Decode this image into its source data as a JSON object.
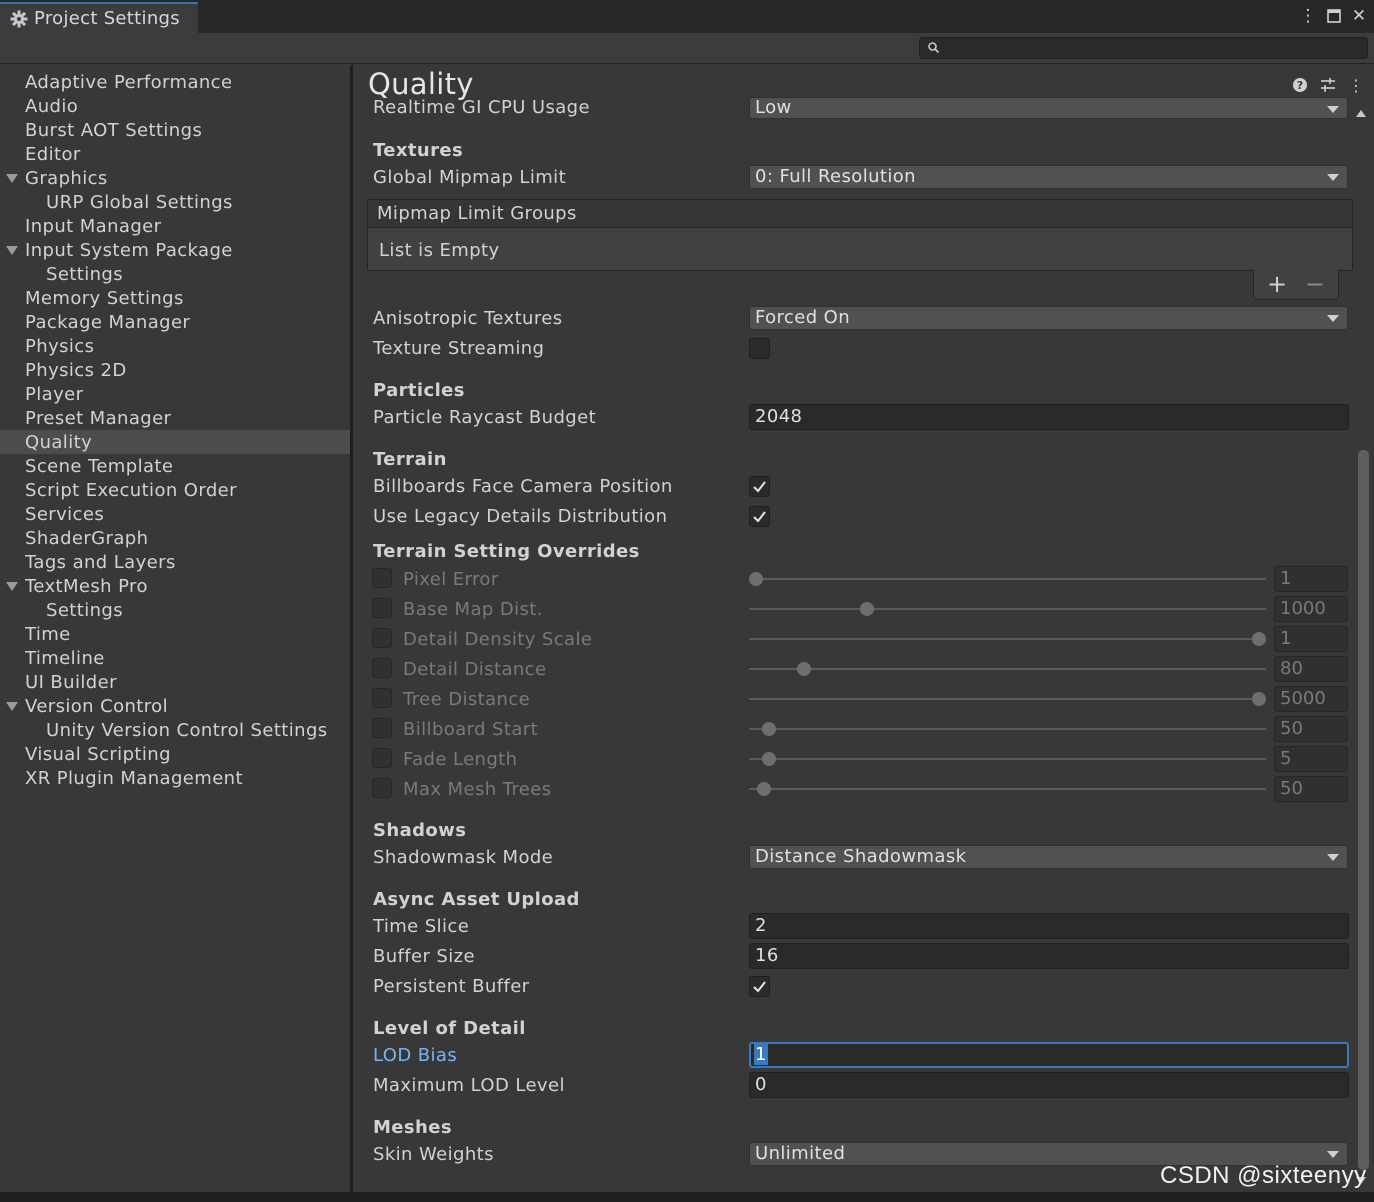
{
  "window": {
    "tab_title": "Project Settings",
    "controls": [
      "more-icon",
      "maximize-icon",
      "close-icon"
    ]
  },
  "search": {
    "value": ""
  },
  "sidebar": {
    "items": [
      {
        "label": "Adaptive Performance",
        "indent": 0,
        "expandable": false
      },
      {
        "label": "Audio",
        "indent": 0,
        "expandable": false
      },
      {
        "label": "Burst AOT Settings",
        "indent": 0,
        "expandable": false
      },
      {
        "label": "Editor",
        "indent": 0,
        "expandable": false
      },
      {
        "label": "Graphics",
        "indent": 0,
        "expandable": true
      },
      {
        "label": "URP Global Settings",
        "indent": 1,
        "expandable": false
      },
      {
        "label": "Input Manager",
        "indent": 0,
        "expandable": false
      },
      {
        "label": "Input System Package",
        "indent": 0,
        "expandable": true
      },
      {
        "label": "Settings",
        "indent": 1,
        "expandable": false
      },
      {
        "label": "Memory Settings",
        "indent": 0,
        "expandable": false
      },
      {
        "label": "Package Manager",
        "indent": 0,
        "expandable": false
      },
      {
        "label": "Physics",
        "indent": 0,
        "expandable": false
      },
      {
        "label": "Physics 2D",
        "indent": 0,
        "expandable": false
      },
      {
        "label": "Player",
        "indent": 0,
        "expandable": false
      },
      {
        "label": "Preset Manager",
        "indent": 0,
        "expandable": false
      },
      {
        "label": "Quality",
        "indent": 0,
        "expandable": false,
        "selected": true
      },
      {
        "label": "Scene Template",
        "indent": 0,
        "expandable": false
      },
      {
        "label": "Script Execution Order",
        "indent": 0,
        "expandable": false
      },
      {
        "label": "Services",
        "indent": 0,
        "expandable": false
      },
      {
        "label": "ShaderGraph",
        "indent": 0,
        "expandable": false
      },
      {
        "label": "Tags and Layers",
        "indent": 0,
        "expandable": false
      },
      {
        "label": "TextMesh Pro",
        "indent": 0,
        "expandable": true
      },
      {
        "label": "Settings",
        "indent": 1,
        "expandable": false
      },
      {
        "label": "Time",
        "indent": 0,
        "expandable": false
      },
      {
        "label": "Timeline",
        "indent": 0,
        "expandable": false
      },
      {
        "label": "UI Builder",
        "indent": 0,
        "expandable": false
      },
      {
        "label": "Version Control",
        "indent": 0,
        "expandable": true
      },
      {
        "label": "Unity Version Control Settings",
        "indent": 1,
        "expandable": false
      },
      {
        "label": "Visual Scripting",
        "indent": 0,
        "expandable": false
      },
      {
        "label": "XR Plugin Management",
        "indent": 0,
        "expandable": false
      }
    ]
  },
  "main": {
    "title": "Quality",
    "header_icons": [
      "help-icon",
      "presets-icon",
      "more-icon"
    ],
    "realtime_gi": {
      "label": "Realtime GI CPU Usage",
      "value": "Low"
    },
    "textures": {
      "section": "Textures",
      "mipmap_limit": {
        "label": "Global Mipmap Limit",
        "value": "0: Full Resolution"
      },
      "mipmap_groups": {
        "header": "Mipmap Limit Groups",
        "empty": "List is Empty",
        "add": "+",
        "remove": "−"
      },
      "anisotropic": {
        "label": "Anisotropic Textures",
        "value": "Forced On"
      },
      "streaming": {
        "label": "Texture Streaming",
        "checked": false
      }
    },
    "particles": {
      "section": "Particles",
      "raycast_budget": {
        "label": "Particle Raycast Budget",
        "value": "2048"
      }
    },
    "terrain": {
      "section": "Terrain",
      "billboards": {
        "label": "Billboards Face Camera Position",
        "checked": true
      },
      "legacy_details": {
        "label": "Use Legacy Details Distribution",
        "checked": true
      }
    },
    "terrain_overrides": {
      "section": "Terrain Setting Overrides",
      "rows": [
        {
          "label": "Pixel Error",
          "value": "1",
          "level": 0.0
        },
        {
          "label": "Base Map Dist.",
          "value": "1000",
          "level": 0.22
        },
        {
          "label": "Detail Density Scale",
          "value": "1",
          "level": 1.0
        },
        {
          "label": "Detail Distance",
          "value": "80",
          "level": 0.095
        },
        {
          "label": "Tree Distance",
          "value": "5000",
          "level": 1.0
        },
        {
          "label": "Billboard Start",
          "value": "50",
          "level": 0.025
        },
        {
          "label": "Fade Length",
          "value": "5",
          "level": 0.025
        },
        {
          "label": "Max Mesh Trees",
          "value": "50",
          "level": 0.015
        }
      ]
    },
    "shadows": {
      "section": "Shadows",
      "shadowmask": {
        "label": "Shadowmask Mode",
        "value": "Distance Shadowmask"
      }
    },
    "async_upload": {
      "section": "Async Asset Upload",
      "time_slice": {
        "label": "Time Slice",
        "value": "2"
      },
      "buffer_size": {
        "label": "Buffer Size",
        "value": "16"
      },
      "persistent": {
        "label": "Persistent Buffer",
        "checked": true
      }
    },
    "lod": {
      "section": "Level of Detail",
      "lod_bias": {
        "label": "LOD Bias",
        "value": "1"
      },
      "max_lod": {
        "label": "Maximum LOD Level",
        "value": "0"
      }
    },
    "meshes": {
      "section": "Meshes",
      "skin_weights": {
        "label": "Skin Weights",
        "value": "Unlimited"
      }
    }
  },
  "watermark": "CSDN @sixteenyy",
  "colors": {
    "accent": "#3a79bb",
    "link": "#7ab4f0",
    "selection": "#4d4d4d",
    "background": "#383838"
  }
}
